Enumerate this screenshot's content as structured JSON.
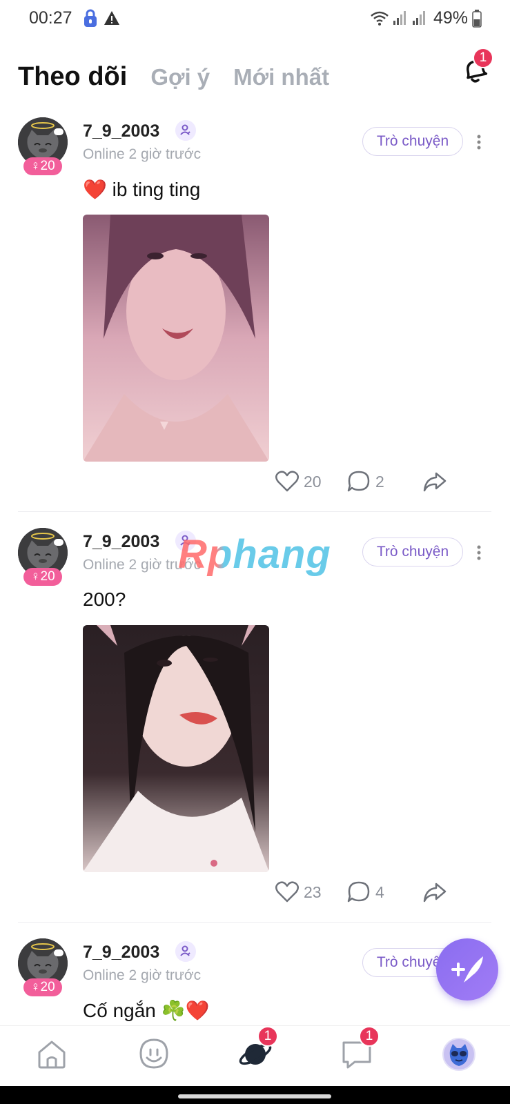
{
  "status_bar": {
    "time": "00:27",
    "battery": "49%"
  },
  "header": {
    "tabs": [
      {
        "label": "Theo dõi",
        "active": true
      },
      {
        "label": "Gợi ý",
        "active": false
      },
      {
        "label": "Mới nhất",
        "active": false
      }
    ],
    "notification_count": "1"
  },
  "watermark": "Rphang",
  "posts": [
    {
      "username": "7_9_2003",
      "online": "Online 2 giờ trước",
      "age": "20",
      "chat_label": "Trò chuyện",
      "text": "❤️ ib ting ting",
      "likes": "20",
      "comments": "2"
    },
    {
      "username": "7_9_2003",
      "online": "Online 2 giờ trước",
      "age": "20",
      "chat_label": "Trò chuyện",
      "text": "200?",
      "likes": "23",
      "comments": "4"
    },
    {
      "username": "7_9_2003",
      "online": "Online 2 giờ trước",
      "age": "20",
      "chat_label": "Trò chuyện",
      "text": "Cố ngắn ☘️❤️"
    }
  ],
  "bottom_nav": {
    "items": [
      {
        "icon": "home-icon"
      },
      {
        "icon": "voice-room-icon"
      },
      {
        "icon": "planet-icon",
        "badge": "1"
      },
      {
        "icon": "chat-icon",
        "badge": "1"
      },
      {
        "icon": "profile-avatar"
      }
    ]
  },
  "colors": {
    "accent": "#8a6df0",
    "badge": "#e8355a",
    "gender_badge": "#f25e9a"
  }
}
